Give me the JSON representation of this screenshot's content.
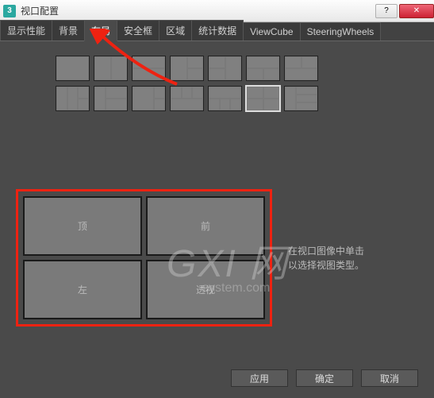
{
  "window": {
    "appIcon": "3",
    "title": "视口配置"
  },
  "tabs": [
    {
      "label": "显示性能",
      "name": "tab-display-perf"
    },
    {
      "label": "背景",
      "name": "tab-background"
    },
    {
      "label": "布局",
      "name": "tab-layout",
      "active": true
    },
    {
      "label": "安全框",
      "name": "tab-safeframe"
    },
    {
      "label": "区域",
      "name": "tab-region"
    },
    {
      "label": "统计数据",
      "name": "tab-stats"
    },
    {
      "label": "ViewCube",
      "name": "tab-viewcube"
    },
    {
      "label": "SteeringWheels",
      "name": "tab-steeringwheels"
    }
  ],
  "preview": {
    "views": [
      "顶",
      "前",
      "左",
      "透视"
    ],
    "hintLine1": "在视口图像中单击",
    "hintLine2": "以选择视图类型。"
  },
  "buttons": {
    "apply": "应用",
    "ok": "确定",
    "cancel": "取消"
  },
  "watermark": {
    "big": "GXI 网",
    "small": "system.com"
  }
}
